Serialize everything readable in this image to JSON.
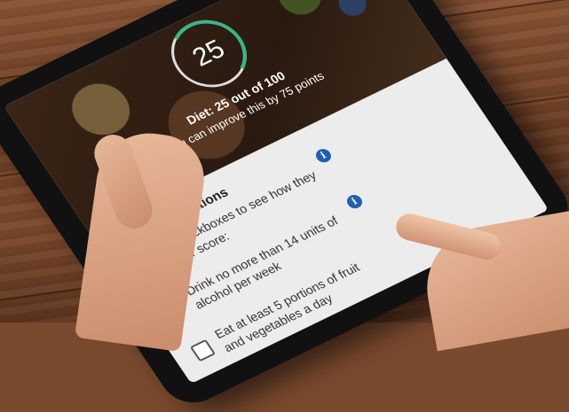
{
  "app": {
    "score": "25",
    "diet_title": "Diet: 25 out of 100",
    "diet_subtitle": "You can improve this by 75 points"
  },
  "recommendations": {
    "title": "Recommendations",
    "intro": "Tick the checkboxes to see how they affect your score:",
    "items": [
      {
        "label": "Drink no more than 14 units of alcohol per week",
        "checked": false
      },
      {
        "label": "Eat at least 5 portions of fruit and vegetables a day",
        "checked": false
      }
    ],
    "info_icon_glyph": "i"
  },
  "colors": {
    "score_arc": "#38b58a",
    "info_icon": "#1f5fb0"
  },
  "score_fraction": 0.25
}
